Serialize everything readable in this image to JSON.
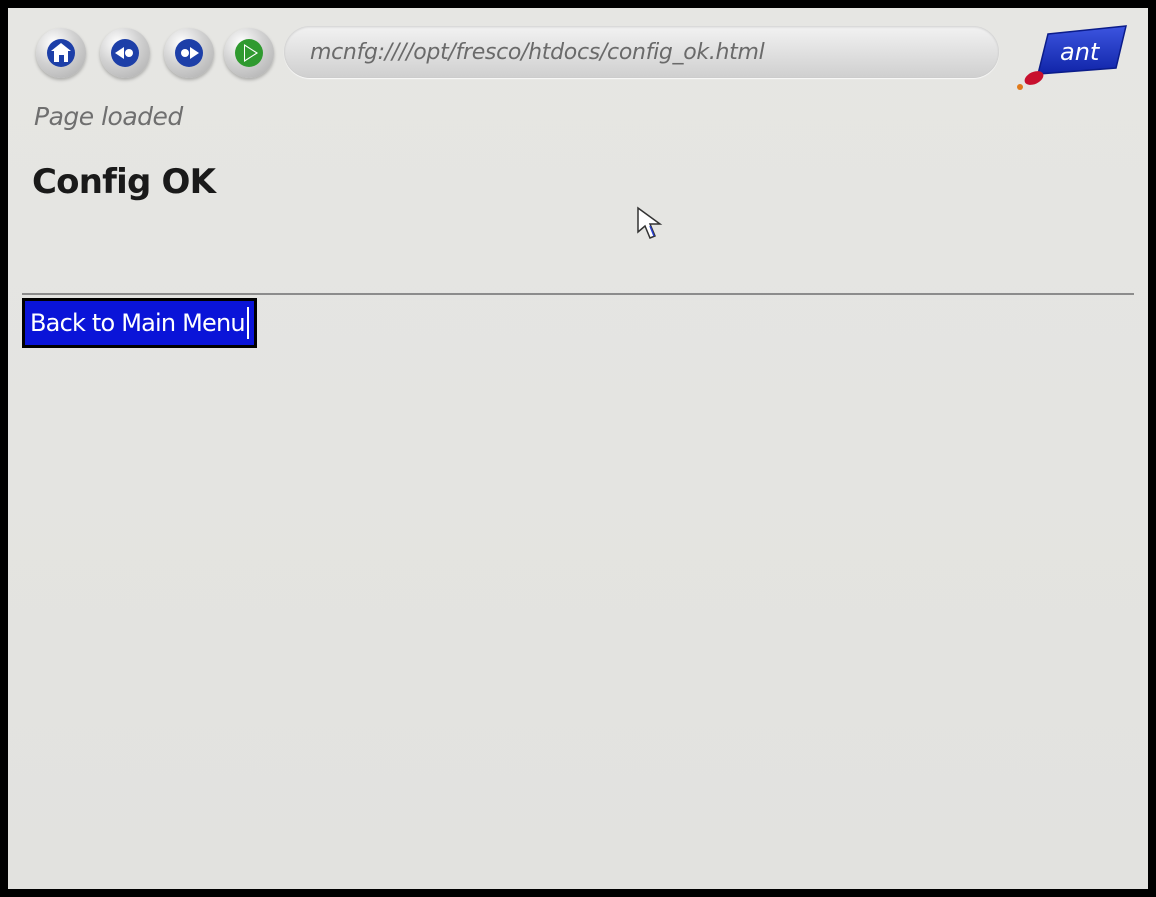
{
  "toolbar": {
    "home_icon": "home-icon",
    "back_icon": "back-icon",
    "forward_icon": "forward-icon",
    "go_icon": "go-icon",
    "address": "mcnfg:////opt/fresco/htdocs/config_ok.html"
  },
  "brand": {
    "logo_text": "ant",
    "logo_color": "#1a33c8",
    "accent_color": "#c8102e"
  },
  "status": {
    "text": "Page loaded"
  },
  "content": {
    "title": "Config OK",
    "back_link": "Back to Main Menu"
  },
  "colors": {
    "link_focus_bg": "#0a14d8",
    "go_button": "#2f9a2f"
  }
}
